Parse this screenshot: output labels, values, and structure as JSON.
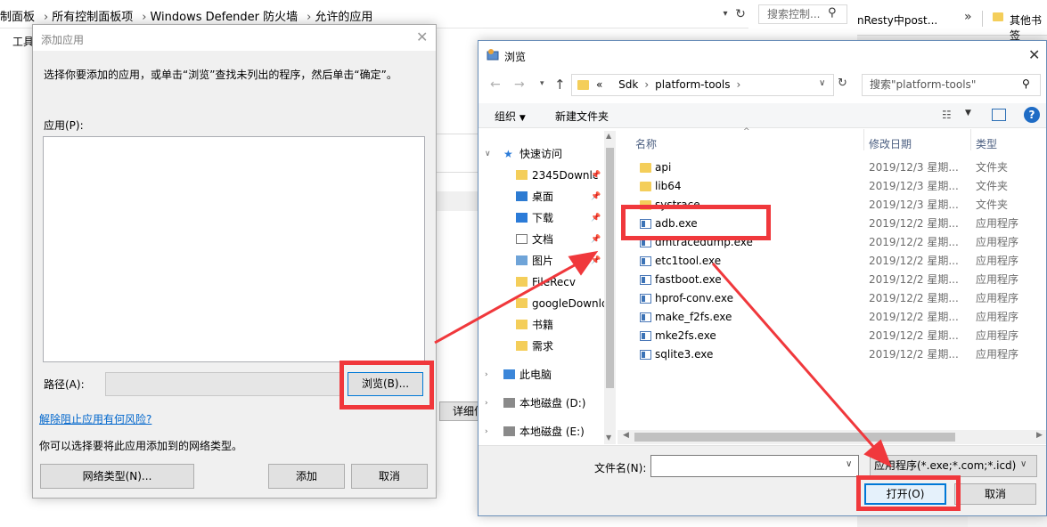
{
  "bg_window": {
    "breadcrumb": [
      "制面板",
      "所有控制面板项",
      "Windows Defender 防火墙",
      "允许的应用"
    ],
    "search_placeholder": "搜索控制...",
    "menu_label": "工具",
    "details_button": "详细信"
  },
  "browser": {
    "tab_text": "nResty中post...",
    "bookmark": "其他书签"
  },
  "add_dialog": {
    "title": "添加应用",
    "instruction": "选择你要添加的应用，或单击“浏览”查找未列出的程序，然后单击“确定”。",
    "apps_label": "应用(P):",
    "path_label": "路径(A):",
    "browse_button": "浏览(B)...",
    "risk_link": "解除阻止应用有何风险?",
    "network_desc": "你可以选择要将此应用添加到的网络类型。",
    "network_type_button": "网络类型(N)...",
    "add_button": "添加",
    "cancel_button": "取消"
  },
  "browse_dialog": {
    "title": "浏览",
    "address": [
      "«",
      "Sdk",
      "platform-tools"
    ],
    "search_placeholder": "搜索\"platform-tools\"",
    "toolbar": {
      "organize": "组织",
      "new_folder": "新建文件夹"
    },
    "nav_items": [
      {
        "label": "快速访问",
        "icon": "star-icon",
        "expandable": true
      },
      {
        "label": "2345Downlc",
        "icon": "folder-icon",
        "pinned": true
      },
      {
        "label": "桌面",
        "icon": "desktop-icon",
        "pinned": true
      },
      {
        "label": "下载",
        "icon": "download-icon",
        "pinned": true
      },
      {
        "label": "文档",
        "icon": "document-icon",
        "pinned": true
      },
      {
        "label": "图片",
        "icon": "picture-icon",
        "pinned": true
      },
      {
        "label": "FileRecv",
        "icon": "folder-icon"
      },
      {
        "label": "googleDownlo",
        "icon": "folder-icon"
      },
      {
        "label": "书籍",
        "icon": "folder-icon"
      },
      {
        "label": "需求",
        "icon": "folder-icon"
      },
      {
        "label": "此电脑",
        "icon": "computer-icon",
        "expandable": true
      },
      {
        "label": "本地磁盘 (D:)",
        "icon": "drive-icon",
        "expandable": true
      },
      {
        "label": "本地磁盘 (E:)",
        "icon": "drive-icon",
        "expandable": true
      }
    ],
    "columns": {
      "name": "名称",
      "date": "修改日期",
      "type": "类型"
    },
    "files": [
      {
        "name": "api",
        "date": "2019/12/3 星期...",
        "type": "文件夹",
        "kind": "folder"
      },
      {
        "name": "lib64",
        "date": "2019/12/3 星期...",
        "type": "文件夹",
        "kind": "folder"
      },
      {
        "name": "systrace",
        "date": "2019/12/3 星期...",
        "type": "文件夹",
        "kind": "folder"
      },
      {
        "name": "adb.exe",
        "date": "2019/12/2 星期...",
        "type": "应用程序",
        "kind": "exe"
      },
      {
        "name": "dmtracedump.exe",
        "date": "2019/12/2 星期...",
        "type": "应用程序",
        "kind": "exe"
      },
      {
        "name": "etc1tool.exe",
        "date": "2019/12/2 星期...",
        "type": "应用程序",
        "kind": "exe"
      },
      {
        "name": "fastboot.exe",
        "date": "2019/12/2 星期...",
        "type": "应用程序",
        "kind": "exe"
      },
      {
        "name": "hprof-conv.exe",
        "date": "2019/12/2 星期...",
        "type": "应用程序",
        "kind": "exe"
      },
      {
        "name": "make_f2fs.exe",
        "date": "2019/12/2 星期...",
        "type": "应用程序",
        "kind": "exe"
      },
      {
        "name": "mke2fs.exe",
        "date": "2019/12/2 星期...",
        "type": "应用程序",
        "kind": "exe"
      },
      {
        "name": "sqlite3.exe",
        "date": "2019/12/2 星期...",
        "type": "应用程序",
        "kind": "exe"
      }
    ],
    "filename_label": "文件名(N):",
    "filename_value": "",
    "filter": "应用程序(*.exe;*.com;*.icd)",
    "open_button": "打开(O)",
    "cancel_button": "取消"
  },
  "colors": {
    "annotation_red": "#f0383c",
    "accent": "#0078d7",
    "folder": "#f4ce5a"
  }
}
